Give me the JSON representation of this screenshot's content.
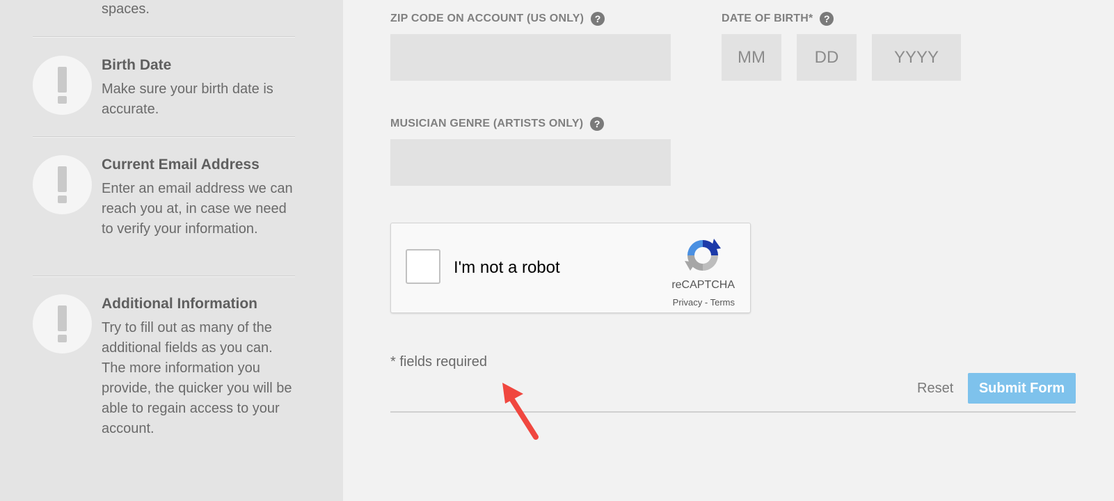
{
  "sidebar": {
    "top_tip_tail": "spaces.",
    "tips": [
      {
        "title": "Birth Date",
        "body": "Make sure your birth date is accurate."
      },
      {
        "title": "Current Email Address",
        "body": "Enter an email address we can reach you at, in case we need to verify your information."
      },
      {
        "title": "Additional Information",
        "body": "Try to fill out as many of the additional fields as you can. The more information you provide, the quicker you will be able to regain access to your account."
      }
    ],
    "tip_icon_glyph": "exclamation-icon"
  },
  "form": {
    "zip": {
      "label": "ZIP CODE ON ACCOUNT (US ONLY)",
      "value": "",
      "placeholder": ""
    },
    "dob": {
      "label": "DATE OF BIRTH*",
      "month_placeholder": "MM",
      "day_placeholder": "DD",
      "year_placeholder": "YYYY"
    },
    "genre": {
      "label": "MUSICIAN GENRE (ARTISTS ONLY)",
      "value": "",
      "placeholder": ""
    },
    "help_glyph": "?",
    "recaptcha": {
      "label": "I'm not a robot",
      "brand": "reCAPTCHA",
      "links": "Privacy - Terms"
    },
    "required_note": "* fields required",
    "reset_label": "Reset",
    "submit_label": "Submit Form"
  },
  "colors": {
    "sidebar_bg": "#e4e4e4",
    "page_bg": "#f2f2f2",
    "input_bg": "#e2e2e2",
    "submit_bg": "#7ec2ec",
    "arrow": "#f0473f"
  }
}
